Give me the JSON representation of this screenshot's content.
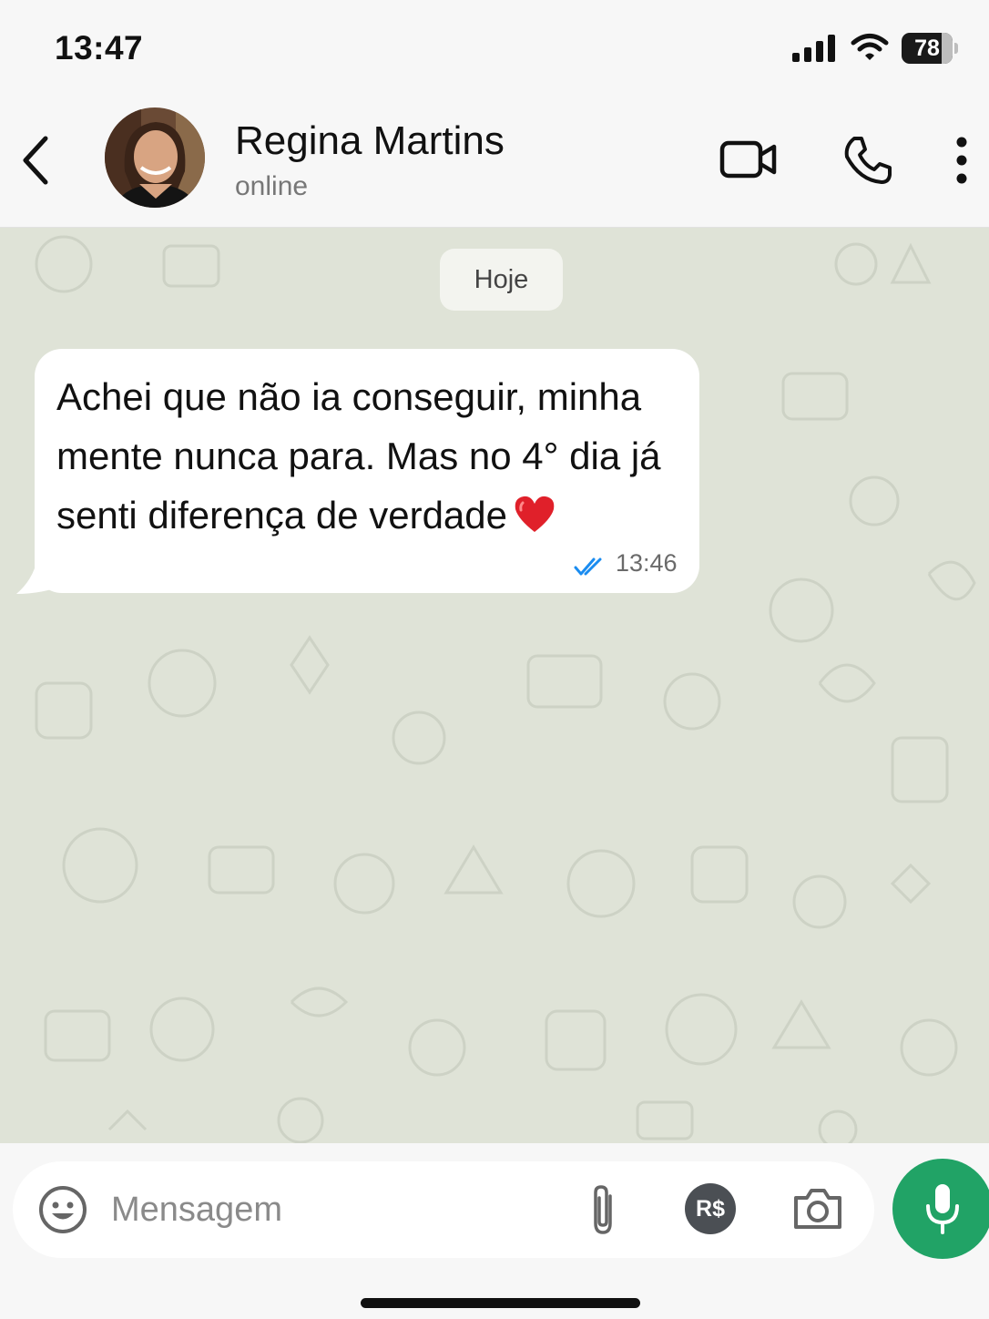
{
  "status_bar": {
    "time": "13:47",
    "battery": "78",
    "battery_level": 0.78
  },
  "header": {
    "back_icon": "chevron-left-icon",
    "contact_name": "Regina Martins",
    "contact_status": "online",
    "actions": [
      "video-call-icon",
      "phone-icon",
      "more-vertical-icon"
    ]
  },
  "chat": {
    "date_label": "Hoje",
    "messages": [
      {
        "text": "Achei que não ia conseguir, minha mente nunca para. Mas no 4° dia já senti diferença de verdade",
        "emoji": "❤️",
        "time": "13:46",
        "status": "read-double-check"
      }
    ]
  },
  "input": {
    "placeholder": "Mensagem",
    "value": "",
    "pix_label": "R$",
    "icons": [
      "emoji-icon",
      "paperclip-icon",
      "camera-icon",
      "microphone-icon"
    ]
  },
  "colors": {
    "header_bg": "#f7f7f7",
    "chat_bg": "#dfe3d7",
    "bubble_bg": "#ffffff",
    "read_check": "#1a8cf0",
    "mic_button": "#21a366"
  }
}
